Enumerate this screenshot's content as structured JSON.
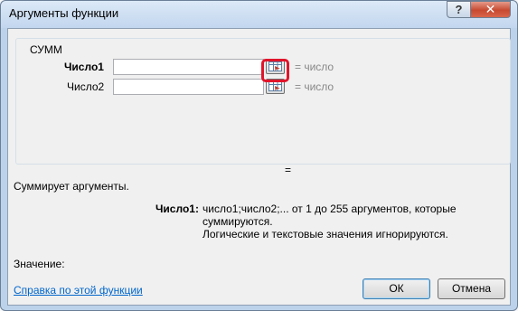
{
  "window": {
    "title": "Аргументы функции",
    "help_button": "?",
    "close_button": "✕"
  },
  "function": {
    "name": "СУММ",
    "args": [
      {
        "label": "Число1",
        "value": "",
        "result": "= число",
        "bold": true
      },
      {
        "label": "Число2",
        "value": "",
        "result": "= число",
        "bold": false
      }
    ],
    "result_eq": "=",
    "description": "Суммирует аргументы.",
    "arg_help_name": "Число1:",
    "arg_help_line1": "число1;число2;... от 1 до 255 аргументов, которые суммируются.",
    "arg_help_line2": "Логические и текстовые значения игнорируются."
  },
  "footer": {
    "value_label": "Значение:",
    "help_link": "Справка по этой функции",
    "ok_label": "ОК",
    "cancel_label": "Отмена"
  },
  "colors": {
    "highlight": "#e0152b",
    "link": "#0066cc"
  }
}
